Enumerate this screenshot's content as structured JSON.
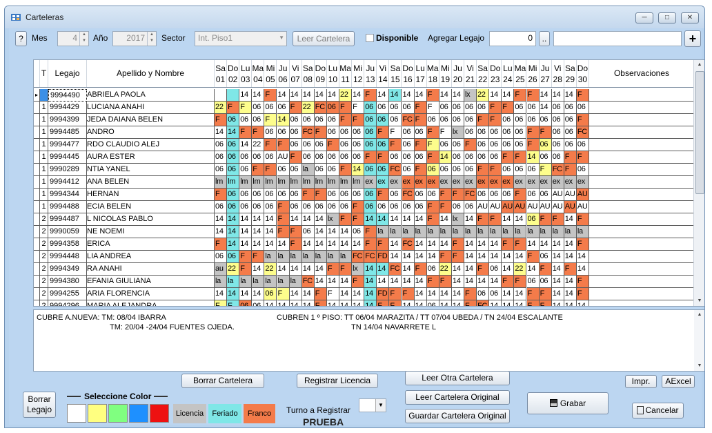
{
  "window": {
    "title": "Carteleras",
    "min_icon": "minimize-icon",
    "max_icon": "maximize-icon",
    "close_icon": "close-icon"
  },
  "toolbar": {
    "help_label": "?",
    "mes_label": "Mes",
    "mes_value": "4",
    "anio_label": "Año",
    "anio_value": "2017",
    "sector_label": "Sector",
    "sector_value": "Int. Piso1",
    "leer_cartelera_label": "Leer Cartelera",
    "disponible_label": "Disponible",
    "agregar_legajo_label": "Agregar Legajo",
    "agregar_legajo_value": "0",
    "dots_label": "..",
    "plus_label": "+"
  },
  "grid": {
    "headers": {
      "t": "T",
      "legajo": "Legajo",
      "nombre": "Apellido y Nombre",
      "obs": "Observaciones"
    },
    "days": [
      [
        "Sa",
        "01"
      ],
      [
        "Do",
        "02"
      ],
      [
        "Lu",
        "03"
      ],
      [
        "Ma",
        "04"
      ],
      [
        "Mi",
        "05"
      ],
      [
        "Ju",
        "06"
      ],
      [
        "Vi",
        "07"
      ],
      [
        "Sa",
        "08"
      ],
      [
        "Do",
        "09"
      ],
      [
        "Lu",
        "10"
      ],
      [
        "Ma",
        "11"
      ],
      [
        "Mi",
        "12"
      ],
      [
        "Ju",
        "13"
      ],
      [
        "Vi",
        "14"
      ],
      [
        "Sa",
        "15"
      ],
      [
        "Do",
        "16"
      ],
      [
        "Lu",
        "17"
      ],
      [
        "Ma",
        "18"
      ],
      [
        "Mi",
        "19"
      ],
      [
        "Ju",
        "20"
      ],
      [
        "Vi",
        "21"
      ],
      [
        "Sa",
        "22"
      ],
      [
        "Do",
        "23"
      ],
      [
        "Lu",
        "24"
      ],
      [
        "Ma",
        "25"
      ],
      [
        "Mi",
        "26"
      ],
      [
        "Ju",
        "27"
      ],
      [
        "Vi",
        "28"
      ],
      [
        "Sa",
        "29"
      ],
      [
        "Do",
        "30"
      ]
    ],
    "rows": [
      {
        "t": "",
        "legajo": "9994490",
        "nombre": "ABRIELA PAOLA",
        "days": [
          "W:",
          "C:",
          "W:14",
          "W:14",
          "F:F",
          "W:14",
          "W:14",
          "W:14",
          "W:14",
          "W:14",
          "Y:22",
          "W:14",
          "F:F",
          "W:14",
          "C:14",
          "W:14",
          "W:14",
          "F:F",
          "W:14",
          "W:14",
          "G:lx",
          "Y:22",
          "W:14",
          "W:14",
          "F:F",
          "F:F",
          "W:14",
          "W:14",
          "W:14",
          "F:F"
        ]
      },
      {
        "t": "1",
        "legajo": "9994429",
        "nombre": "LUCIANA ANAHI",
        "days": [
          "Y:22",
          "F:F",
          "Y:F",
          "W:06",
          "W:06",
          "W:06",
          "F:F",
          "Y:22",
          "F:FC",
          "F:06",
          "F:F",
          "W:F",
          "C:06",
          "W:06",
          "W:06",
          "W:06",
          "F:F",
          "W:F",
          "W:06",
          "W:06",
          "W:06",
          "W:06",
          "F:F",
          "F:F",
          "W:06",
          "W:06",
          "W:14",
          "W:06",
          "W:06",
          "W:06"
        ]
      },
      {
        "t": "1",
        "legajo": "9994399",
        "nombre": "JEDA DAIANA BELEN",
        "days": [
          "F:F",
          "C:06",
          "W:06",
          "W:06",
          "Y:F",
          "Y:14",
          "W:06",
          "W:06",
          "W:06",
          "W:06",
          "F:F",
          "F:F",
          "C:06",
          "C:06",
          "W:06",
          "F:FC",
          "F:F",
          "W:06",
          "W:06",
          "W:06",
          "W:06",
          "F:F",
          "F:F",
          "W:06",
          "W:06",
          "W:06",
          "W:06",
          "W:06",
          "W:06",
          "F:F"
        ]
      },
      {
        "t": "1",
        "legajo": "9994485",
        "nombre": "ANDRO",
        "days": [
          "W:14",
          "C:14",
          "F:F",
          "F:F",
          "W:06",
          "W:06",
          "W:06",
          "F:FC",
          "F:F",
          "W:06",
          "W:06",
          "W:06",
          "C:06",
          "F:F",
          "W:F",
          "W:06",
          "W:06",
          "F:F",
          "W:F",
          "G:lx",
          "W:06",
          "W:06",
          "W:06",
          "W:06",
          "W:06",
          "F:F",
          "F:F",
          "W:06",
          "W:06",
          "F:FC"
        ]
      },
      {
        "t": "1",
        "legajo": "9994477",
        "nombre": "RDO CLAUDIO ALEJ",
        "days": [
          "W:06",
          "C:06",
          "W:14",
          "W:22",
          "F:F",
          "F:F",
          "W:06",
          "W:06",
          "W:06",
          "F:F",
          "W:06",
          "W:06",
          "C:06",
          "C:06",
          "F:F",
          "W:06",
          "F:F",
          "Y:F",
          "W:06",
          "W:06",
          "F:F",
          "W:06",
          "W:06",
          "W:06",
          "W:06",
          "F:F",
          "Y:06",
          "W:06",
          "W:06",
          "W:06"
        ]
      },
      {
        "t": "1",
        "legajo": "9994445",
        "nombre": "AURA ESTER",
        "days": [
          "W:06",
          "C:06",
          "W:06",
          "W:06",
          "W:06",
          "W:AU",
          "F:F",
          "W:06",
          "W:06",
          "W:06",
          "W:06",
          "W:06",
          "F:F",
          "F:F",
          "W:06",
          "W:06",
          "W:06",
          "F:F",
          "Y:14",
          "W:06",
          "W:06",
          "W:06",
          "W:06",
          "F:F",
          "F:F",
          "Y:14",
          "W:06",
          "W:06",
          "F:F",
          "F:F"
        ]
      },
      {
        "t": "1",
        "legajo": "9990289",
        "nombre": "NTIA YANEL",
        "days": [
          "W:06",
          "C:06",
          "W:06",
          "F:F",
          "F:F",
          "W:06",
          "W:06",
          "G:la",
          "W:06",
          "W:06",
          "F:F",
          "Y:14",
          "C:06",
          "C:06",
          "F:FC",
          "W:06",
          "F:F",
          "Y:06",
          "W:06",
          "W:06",
          "W:06",
          "F:F",
          "F:F",
          "W:06",
          "W:06",
          "W:06",
          "Y:F",
          "F:FC",
          "F:F",
          "W:06"
        ]
      },
      {
        "t": "1",
        "legajo": "9994412",
        "nombre": "ANA BELEN",
        "days": [
          "G:lm",
          "C:lm",
          "G:lm",
          "G:lm",
          "G:lm",
          "G:lm",
          "G:lm",
          "G:lm",
          "G:lm",
          "G:lm",
          "G:lm",
          "G:lm",
          "G:ex",
          "C:ex",
          "G:ex",
          "F:ex",
          "F:ex",
          "F:ex",
          "G:ex",
          "G:ex",
          "G:ex",
          "F:ex",
          "F:ex",
          "F:ex",
          "G:ex",
          "G:ex",
          "G:ex",
          "G:ex",
          "G:ex",
          "G:ex"
        ]
      },
      {
        "t": "1",
        "legajo": "9994344",
        "nombre": "HERNAN",
        "days": [
          "F:F",
          "C:06",
          "W:06",
          "W:06",
          "W:06",
          "W:06",
          "W:06",
          "F:F",
          "F:F",
          "W:06",
          "W:06",
          "W:06",
          "C:06",
          "F:F",
          "W:06",
          "F:FC",
          "W:06",
          "W:06",
          "F:F",
          "F:F",
          "F:FC",
          "W:06",
          "W:06",
          "W:06",
          "F:F",
          "W:06",
          "W:06",
          "W:AU",
          "W:AU",
          "F:AU"
        ]
      },
      {
        "t": "1",
        "legajo": "9994488",
        "nombre": "ECIA BELEN",
        "days": [
          "W:06",
          "C:06",
          "W:06",
          "W:06",
          "W:06",
          "F:F",
          "W:06",
          "W:06",
          "W:06",
          "W:06",
          "W:06",
          "F:F",
          "C:06",
          "W:06",
          "W:06",
          "W:06",
          "W:06",
          "F:F",
          "F:F",
          "W:06",
          "W:06",
          "W:AU",
          "W:AU",
          "F:AU",
          "F:AU",
          "W:AU",
          "W:AU",
          "W:AU",
          "F:AU",
          "W:AU"
        ]
      },
      {
        "t": "2",
        "legajo": "9994487",
        "nombre": "L NICOLAS PABLO",
        "days": [
          "W:14",
          "C:14",
          "W:14",
          "W:14",
          "W:14",
          "F:F",
          "W:14",
          "W:14",
          "W:14",
          "G:lx",
          "F:F",
          "F:F",
          "C:14",
          "C:14",
          "W:14",
          "W:14",
          "W:14",
          "F:F",
          "W:14",
          "G:lx",
          "W:14",
          "F:F",
          "F:F",
          "W:14",
          "W:14",
          "Y:06",
          "F:F",
          "F:F",
          "W:14",
          "F:F"
        ]
      },
      {
        "t": "2",
        "legajo": "9990059",
        "nombre": "NE NOEMI",
        "days": [
          "W:14",
          "C:14",
          "W:14",
          "W:14",
          "W:14",
          "F:F",
          "F:F",
          "W:06",
          "W:14",
          "W:14",
          "W:14",
          "W:06",
          "F:F",
          "G:la",
          "G:la",
          "G:la",
          "G:la",
          "G:la",
          "G:la",
          "G:la",
          "G:la",
          "G:la",
          "G:la",
          "G:la",
          "G:la",
          "G:la",
          "G:la",
          "G:la",
          "G:la",
          "G:la"
        ]
      },
      {
        "t": "2",
        "legajo": "9994358",
        "nombre": "ERICA",
        "days": [
          "F:F",
          "C:14",
          "W:14",
          "W:14",
          "W:14",
          "W:14",
          "F:F",
          "W:14",
          "W:14",
          "W:14",
          "W:14",
          "W:14",
          "F:F",
          "F:F",
          "W:14",
          "F:FC",
          "W:14",
          "W:14",
          "W:14",
          "F:F",
          "W:14",
          "W:14",
          "W:14",
          "F:F",
          "F:F",
          "W:14",
          "W:14",
          "W:14",
          "W:14",
          "F:F"
        ]
      },
      {
        "t": "2",
        "legajo": "9994448",
        "nombre": "LIA ANDREA",
        "days": [
          "W:06",
          "C:06",
          "F:F",
          "F:F",
          "G:la",
          "G:la",
          "G:la",
          "G:la",
          "G:la",
          "G:la",
          "G:la",
          "F:FC",
          "F:FC",
          "F:FD",
          "W:14",
          "W:14",
          "W:14",
          "W:14",
          "F:F",
          "F:F",
          "W:14",
          "W:14",
          "W:14",
          "W:14",
          "W:14",
          "F:F",
          "W:06",
          "W:14",
          "W:14",
          "W:14"
        ]
      },
      {
        "t": "2",
        "legajo": "9994349",
        "nombre": "RA ANAHI",
        "days": [
          "G:au",
          "Y:22",
          "F:F",
          "W:14",
          "Y:22",
          "W:14",
          "W:14",
          "W:14",
          "W:14",
          "F:F",
          "F:F",
          "G:lx",
          "C:14",
          "C:14",
          "F:FC",
          "W:14",
          "F:F",
          "W:06",
          "Y:22",
          "W:14",
          "W:14",
          "F:F",
          "W:06",
          "W:14",
          "Y:22",
          "W:14",
          "F:F",
          "W:14",
          "F:F",
          "W:14"
        ]
      },
      {
        "t": "2",
        "legajo": "9994380",
        "nombre": "EFANIA GIULIANA",
        "days": [
          "G:la",
          "C:la",
          "G:la",
          "G:la",
          "G:la",
          "G:la",
          "G:la",
          "F:FC",
          "W:14",
          "W:14",
          "W:14",
          "F:F",
          "C:14",
          "W:14",
          "W:14",
          "W:14",
          "W:14",
          "F:F",
          "F:F",
          "W:14",
          "W:14",
          "W:14",
          "W:14",
          "F:F",
          "F:F",
          "W:06",
          "W:06",
          "W:14",
          "W:14",
          "F:F"
        ]
      },
      {
        "t": "2",
        "legajo": "9994255",
        "nombre": "ARIA FLORENCIA",
        "days": [
          "W:14",
          "C:14",
          "W:14",
          "W:14",
          "Y:06",
          "Y:F",
          "W:14",
          "W:14",
          "F:F",
          "W:F",
          "W:14",
          "W:14",
          "C:14",
          "F:FD",
          "F:F",
          "F:F",
          "W:14",
          "W:14",
          "W:14",
          "W:14",
          "F:F",
          "W:06",
          "W:06",
          "W:14",
          "W:14",
          "F:F",
          "F:F",
          "W:14",
          "W:14",
          "F:F"
        ]
      },
      {
        "t": "2",
        "legajo": "9994296",
        "nombre": "MARIA ALEJANDRA",
        "days": [
          "Y:F",
          "C:F",
          "F:06",
          "W:06",
          "W:14",
          "W:14",
          "W:14",
          "W:14",
          "F:F",
          "W:14",
          "W:14",
          "W:14",
          "C:14",
          "F:F",
          "F:F",
          "W:14",
          "W:14",
          "W:06",
          "W:14",
          "W:14",
          "F:F",
          "F:FC",
          "W:14",
          "W:14",
          "W:14",
          "F:F",
          "F:F",
          "W:14",
          "W:14",
          "W:14"
        ]
      }
    ]
  },
  "notes": {
    "line1a": "CUBRE A.NUEVA: TM: 08/04 IBARRA",
    "line1b": "CUBREN 1 º PISO: TT 06/04 MARAZITA / TT 07/04 UBEDA /   TN 24/04 ESCALANTE",
    "line2a": "TM: 20/04 -24/04 FUENTES OJEDA.",
    "line2b": "TN 14/04 NAVARRETE L"
  },
  "bottom": {
    "borrar_legajo_l1": "Borrar",
    "borrar_legajo_l2": "Legajo",
    "seleccione_color": "Seleccione Color",
    "swatch_colors": [
      "#ffffff",
      "#ffff80",
      "#80ff80",
      "#1e90ff",
      "#ee1111"
    ],
    "licencia": "Licencia",
    "feriado": "Feriado",
    "franco": "Franco",
    "borrar_cartelera": "Borrar Cartelera",
    "registrar_licencia": "Registrar Licencia",
    "turno_label": "Turno a Registrar",
    "prueba": "PRUEBA",
    "leer_otra": "Leer Otra Cartelera",
    "leer_original": "Leer Cartelera Original",
    "guardar_original": "Guardar Cartelera Original",
    "grabar": "Grabar",
    "impr": "Impr.",
    "aexcel": "AExcel",
    "cancelar": "Cancelar"
  }
}
